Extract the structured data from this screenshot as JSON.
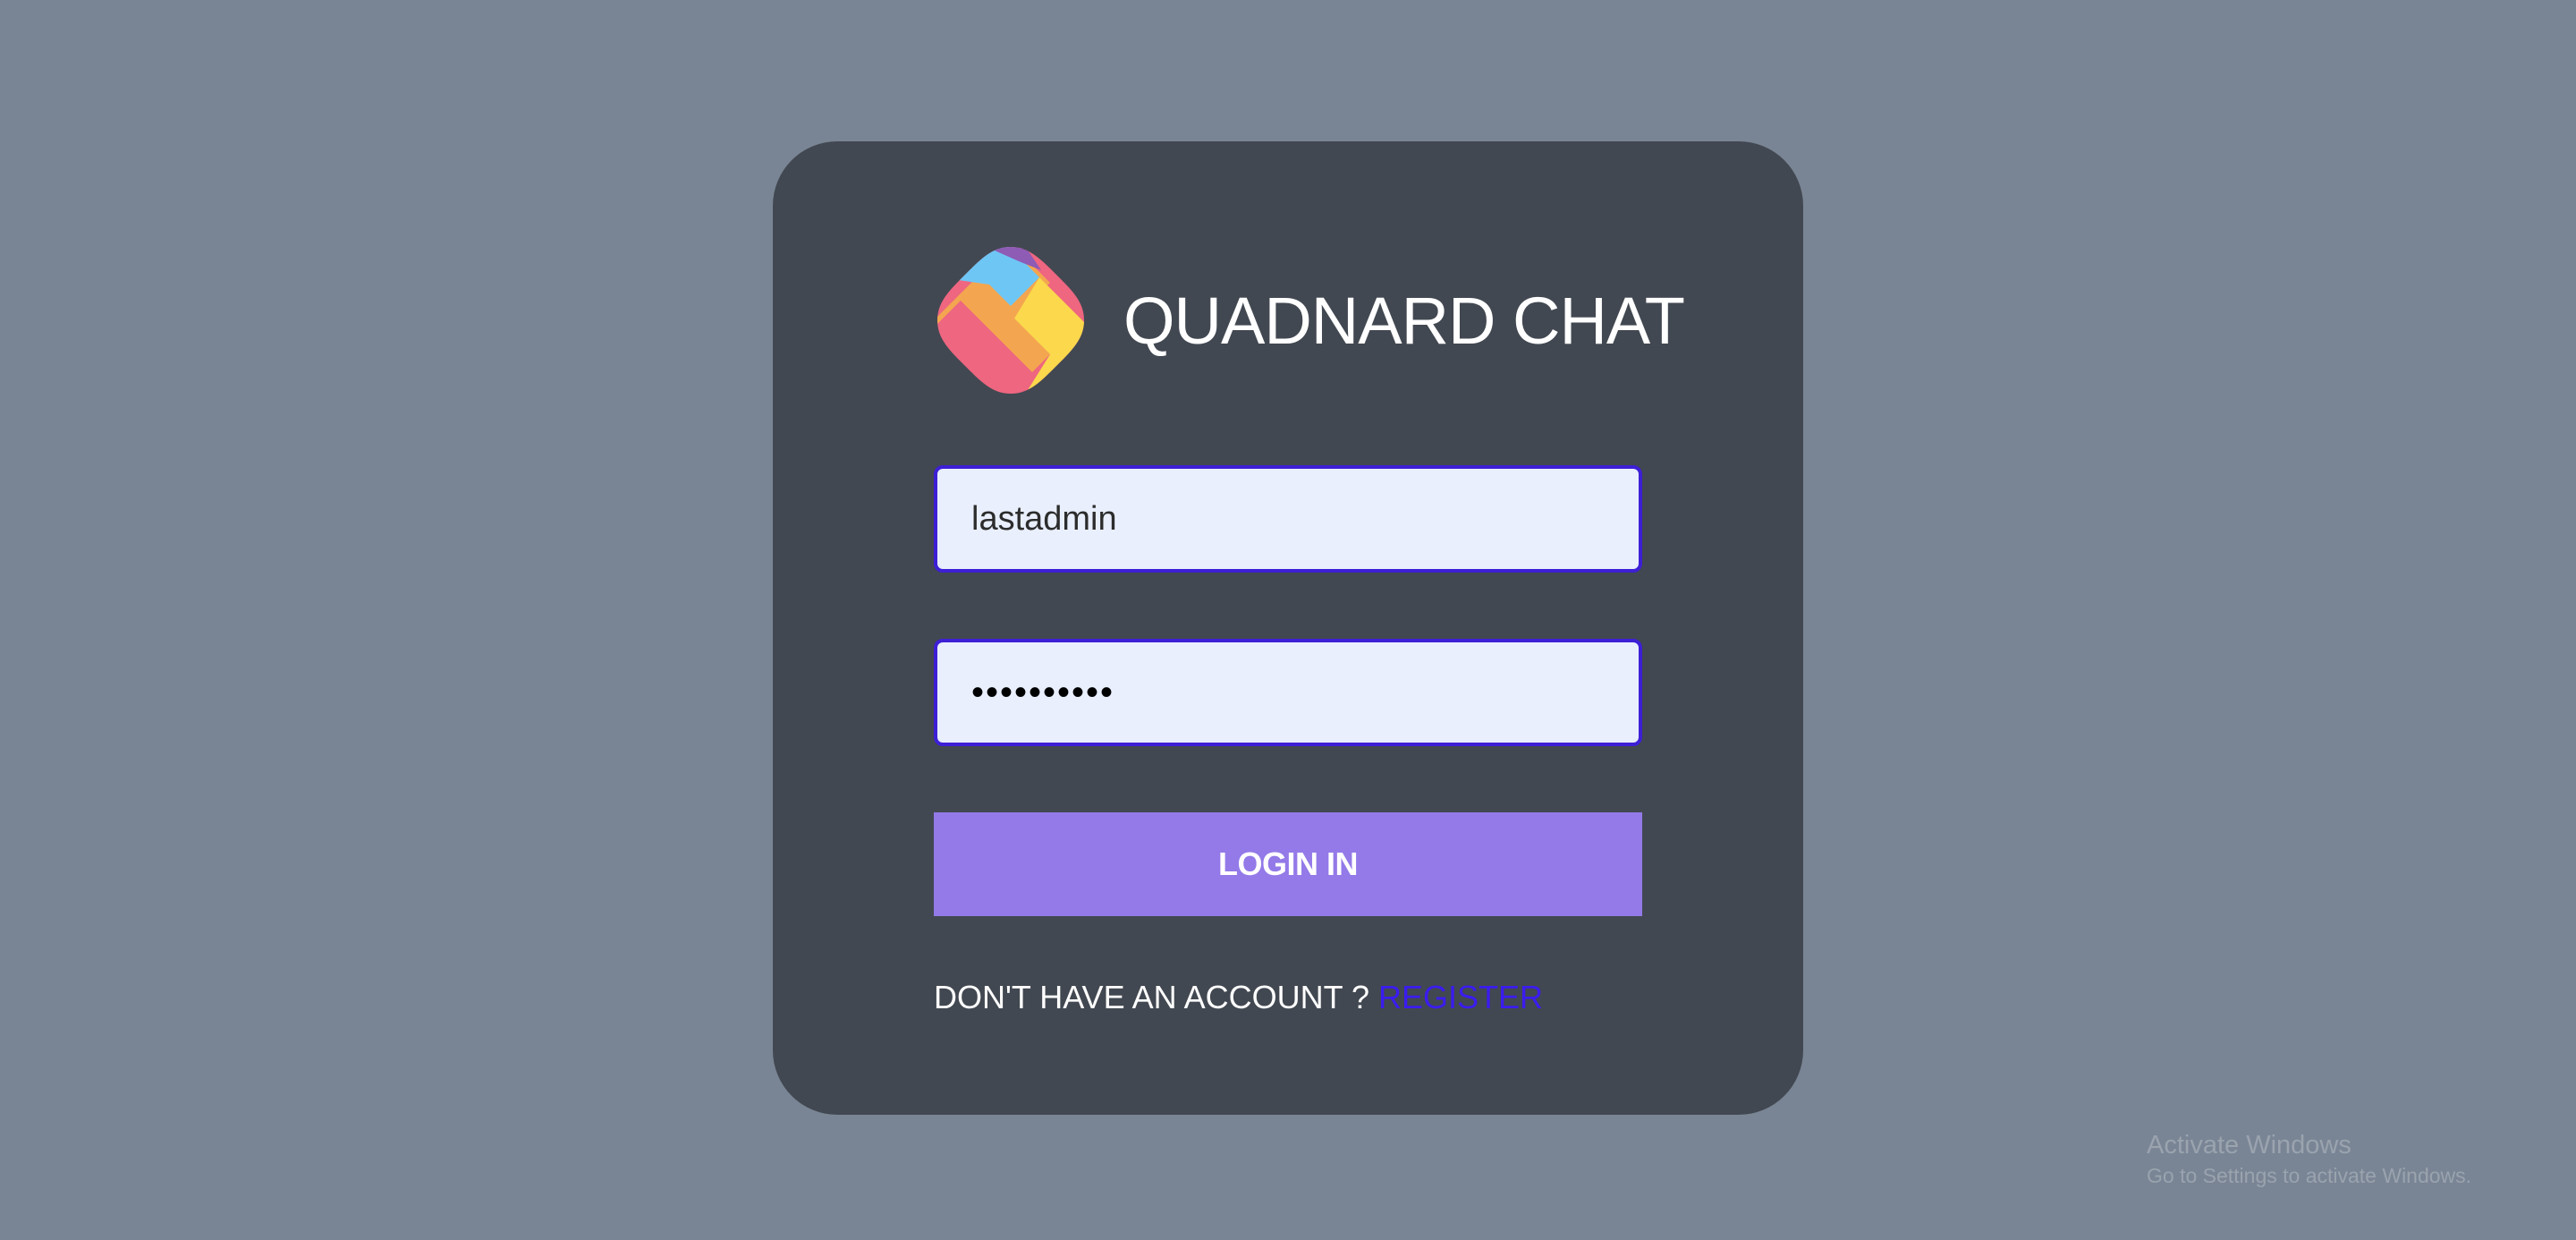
{
  "app": {
    "title": "QUADNARD CHAT",
    "logo_icon": "quadnard-logo-icon"
  },
  "form": {
    "username_value": "lastadmin",
    "password_value": "••••••••••",
    "login_button_label": "LOGIN IN",
    "register_prompt": "DON'T HAVE AN ACCOUNT ? ",
    "register_link_label": "REGISTER"
  },
  "watermark": {
    "title": "Activate Windows",
    "subtitle": "Go to Settings to activate Windows."
  },
  "colors": {
    "page_background": "#798595",
    "card_background": "#424851",
    "input_background": "#e9effd",
    "input_border": "#3d1fd6",
    "button_background": "#937ae8",
    "link": "#3b1cf0",
    "logo_purple": "#8e5bb5",
    "logo_blue": "#6ec6f5",
    "logo_orange": "#f3a64f",
    "logo_red": "#ee6680",
    "logo_yellow": "#fbd84c"
  }
}
